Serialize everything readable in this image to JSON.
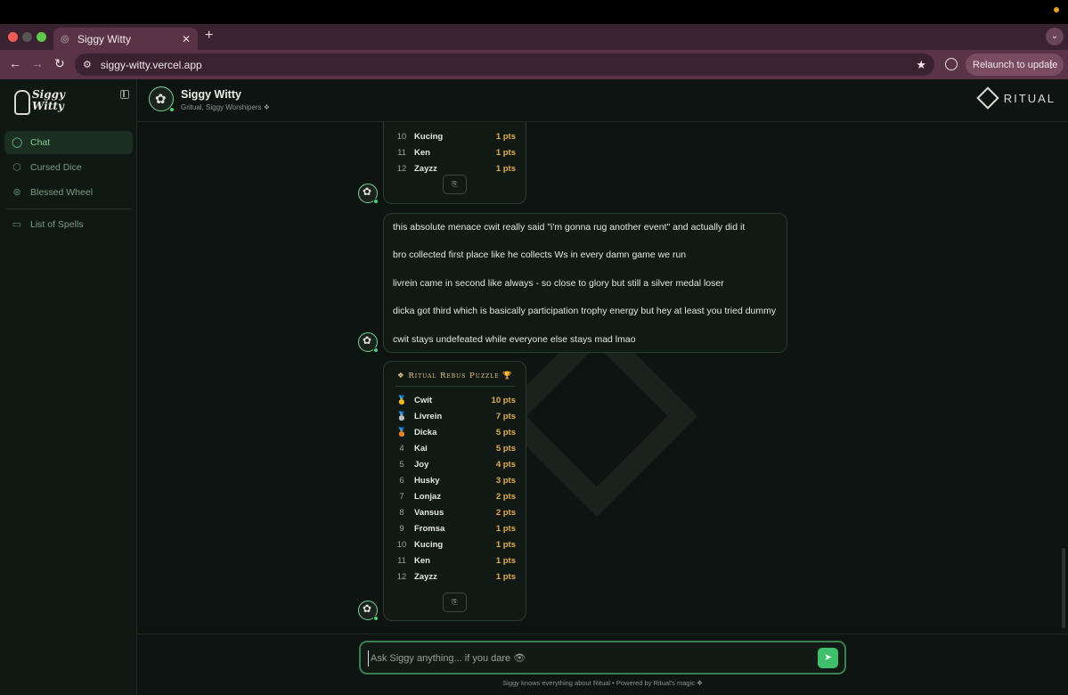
{
  "browser": {
    "tab_title": "Siggy Witty",
    "url": "siggy-witty.vercel.app",
    "relaunch_label": "Relaunch to update",
    "new_tab_glyph": "+",
    "close_tab_glyph": "✕"
  },
  "sidebar": {
    "logo_line1": "Siggy",
    "logo_line2": "Witty",
    "items": [
      {
        "label": "Chat",
        "icon": "chat-bubble-icon",
        "active": true
      },
      {
        "label": "Cursed Dice",
        "icon": "dice-icon",
        "active": false
      },
      {
        "label": "Blessed Wheel",
        "icon": "wheel-icon",
        "active": false
      },
      {
        "label": "List of Spells",
        "icon": "spellbook-icon",
        "active": false
      }
    ]
  },
  "header": {
    "title": "Siggy Witty",
    "subtitle": "Gritual, Siggy Worshipers ❖",
    "brand": "RITUAL"
  },
  "chat": {
    "partial_leaderboard": [
      {
        "rank": "10",
        "name": "Kucing",
        "pts": "1 pts"
      },
      {
        "rank": "11",
        "name": "Ken",
        "pts": "1 pts"
      },
      {
        "rank": "12",
        "name": "Zayzz",
        "pts": "1 pts"
      }
    ],
    "copy_glyph": "⎘",
    "message_lines": [
      "this absolute menace cwit really said \"i'm gonna rug another event\" and actually did it",
      "bro collected first place like he collects Ws in every damn game we run",
      "livrein came in second like always - so close to glory but still a silver medal loser",
      "dicka got third which is basically participation trophy energy but hey at least you tried dummy",
      "cwit stays undefeated while everyone else stays mad lmao"
    ],
    "leaderboard_title": "❖ Ritual Rebus Puzzle 🏆",
    "leaderboard": [
      {
        "rank": "🥇",
        "name": "Cwit",
        "pts": "10 pts"
      },
      {
        "rank": "🥈",
        "name": "Livrein",
        "pts": "7 pts"
      },
      {
        "rank": "🥉",
        "name": "Dicka",
        "pts": "5 pts"
      },
      {
        "rank": "4",
        "name": "Kai",
        "pts": "5 pts"
      },
      {
        "rank": "5",
        "name": "Joy",
        "pts": "4 pts"
      },
      {
        "rank": "6",
        "name": "Husky",
        "pts": "3 pts"
      },
      {
        "rank": "7",
        "name": "Lonjaz",
        "pts": "2 pts"
      },
      {
        "rank": "8",
        "name": "Vansus",
        "pts": "2 pts"
      },
      {
        "rank": "9",
        "name": "Fromsa",
        "pts": "1 pts"
      },
      {
        "rank": "10",
        "name": "Kucing",
        "pts": "1 pts"
      },
      {
        "rank": "11",
        "name": "Ken",
        "pts": "1 pts"
      },
      {
        "rank": "12",
        "name": "Zayzz",
        "pts": "1 pts"
      }
    ]
  },
  "composer": {
    "placeholder": "Ask Siggy anything... if you dare 👁",
    "value": "",
    "footer": "Siggy knows everything about Ritual • Powered by Ritual's magic ❖"
  },
  "colors": {
    "accent": "#3fbf6a",
    "points": "#e2ad4c",
    "background": "#0e1411"
  }
}
